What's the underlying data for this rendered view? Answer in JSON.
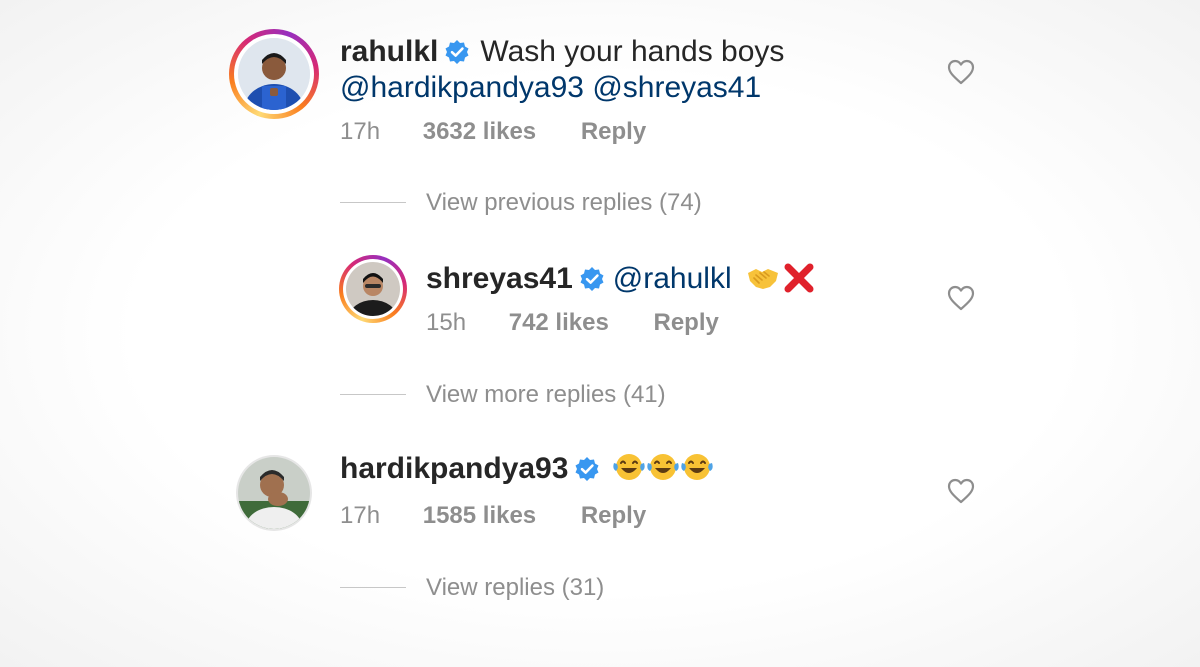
{
  "comments": [
    {
      "username": "rahulkl",
      "text": "Wash your hands boys",
      "mentions": [
        "@hardikpandya93",
        "@shreyas41"
      ],
      "time": "17h",
      "likes": "3632 likes",
      "reply_label": "Reply",
      "view_replies": "View previous replies (74)"
    },
    {
      "username": "shreyas41",
      "mention": "@rahulkl",
      "emojis": [
        "handshake-emoji",
        "cross-mark-emoji"
      ],
      "time": "15h",
      "likes": "742 likes",
      "reply_label": "Reply",
      "view_replies": "View more replies (41)"
    },
    {
      "username": "hardikpandya93",
      "emojis": [
        "face-with-tears-of-joy-emoji",
        "face-with-tears-of-joy-emoji",
        "face-with-tears-of-joy-emoji"
      ],
      "time": "17h",
      "likes": "1585 likes",
      "reply_label": "Reply",
      "view_replies": "View replies (31)"
    }
  ],
  "colors": {
    "username": "#262626",
    "mention": "#00376b",
    "meta": "#8e8e8e",
    "verified": "#3897f0"
  },
  "icons": {
    "verified": "verified-badge-icon",
    "like": "heart-icon"
  }
}
